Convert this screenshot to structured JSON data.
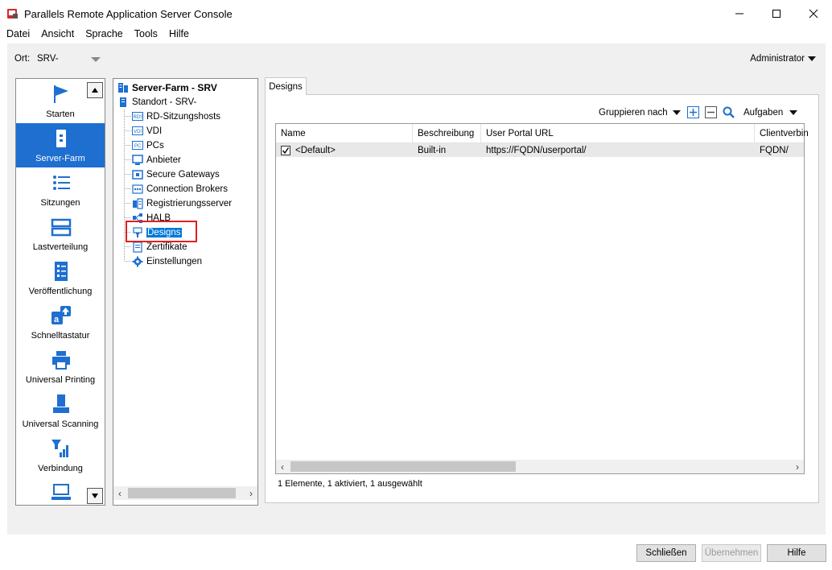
{
  "window": {
    "title": "Parallels Remote Application Server Console",
    "controls": [
      "minimize",
      "maximize",
      "close"
    ]
  },
  "menu": [
    "Datei",
    "Ansicht",
    "Sprache",
    "Tools",
    "Hilfe"
  ],
  "location": {
    "label": "Ort:",
    "value": "SRV-"
  },
  "user": {
    "label": "Administrator"
  },
  "categories": [
    {
      "label": "Starten",
      "icon": "flag-icon"
    },
    {
      "label": "Server-Farm",
      "icon": "server-icon",
      "active": true
    },
    {
      "label": "Sitzungen",
      "icon": "list-icon"
    },
    {
      "label": "Lastverteilung",
      "icon": "load-balancing-icon"
    },
    {
      "label": "Veröffentlichung",
      "icon": "publishing-icon"
    },
    {
      "label": "Schnelltastatur",
      "icon": "quick-keyboard-icon"
    },
    {
      "label": "Universal Printing",
      "icon": "printer-icon"
    },
    {
      "label": "Universal Scanning",
      "icon": "scanner-icon"
    },
    {
      "label": "Verbindung",
      "icon": "connection-icon"
    },
    {
      "label": "",
      "icon": "computer-icon"
    }
  ],
  "tree": {
    "root": "Server-Farm - SRV",
    "site": "Standort - SRV-",
    "items": [
      {
        "label": "RD-Sitzungshosts",
        "icon": "rds-icon"
      },
      {
        "label": "VDI",
        "icon": "vdi-icon"
      },
      {
        "label": "PCs",
        "icon": "pc-icon"
      },
      {
        "label": "Anbieter",
        "icon": "provider-icon"
      },
      {
        "label": "Secure Gateways",
        "icon": "gateway-icon"
      },
      {
        "label": "Connection Brokers",
        "icon": "broker-icon"
      },
      {
        "label": "Registrierungsserver",
        "icon": "registration-icon"
      },
      {
        "label": "HALB",
        "icon": "halb-icon"
      },
      {
        "label": "Designs",
        "icon": "designs-icon",
        "selected": true
      },
      {
        "label": "Zertifikate",
        "icon": "certificate-icon"
      },
      {
        "label": "Einstellungen",
        "icon": "settings-gear-icon"
      }
    ]
  },
  "content": {
    "tab": "Designs",
    "toolbar": {
      "group_by": "Gruppieren nach",
      "tasks": "Aufgaben"
    },
    "columns": [
      "Name",
      "Beschreibung",
      "User Portal URL",
      "Clientverbin"
    ],
    "rows": [
      {
        "checked": true,
        "name": "<Default>",
        "description": "Built-in",
        "url": "https://FQDN/userportal/",
        "client": "FQDN/"
      }
    ],
    "status": "1 Elemente, 1 aktiviert, 1 ausgewählt"
  },
  "footer": {
    "close": "Schließen",
    "apply": "Übernehmen",
    "help": "Hilfe"
  }
}
